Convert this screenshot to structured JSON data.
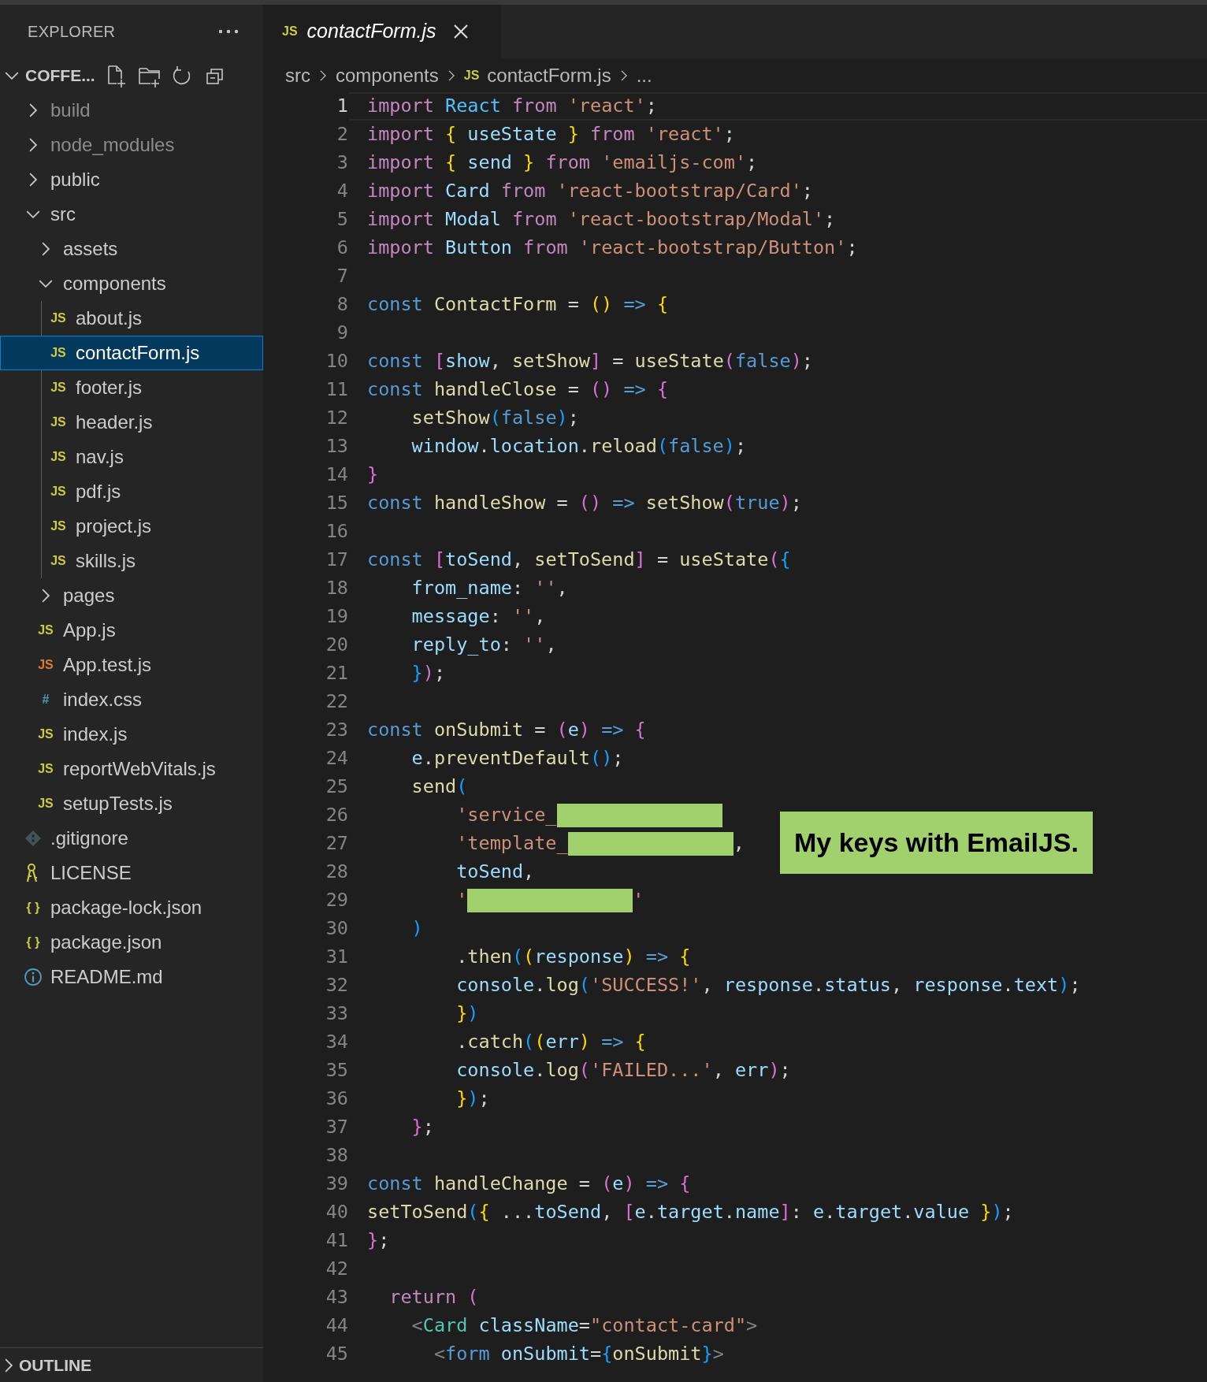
{
  "explorer": {
    "title": "EXPLORER"
  },
  "project": {
    "name": "COFFE...",
    "expanded": true
  },
  "tree": [
    {
      "label": "build",
      "kind": "folder",
      "expanded": false,
      "selected": false,
      "ignored": true
    },
    {
      "label": "node_modules",
      "kind": "folder",
      "expanded": false,
      "selected": false,
      "ignored": true
    },
    {
      "label": "public",
      "kind": "folder",
      "expanded": false,
      "selected": false
    },
    {
      "label": "src",
      "kind": "folder",
      "expanded": true,
      "selected": false,
      "children": [
        {
          "label": "assets",
          "kind": "folder",
          "expanded": false,
          "selected": false
        },
        {
          "label": "components",
          "kind": "folder",
          "expanded": true,
          "selected": false,
          "children": [
            {
              "label": "about.js",
              "kind": "js",
              "icon_text": "JS",
              "selected": false
            },
            {
              "label": "contactForm.js",
              "kind": "js",
              "icon_text": "JS",
              "selected": true
            },
            {
              "label": "footer.js",
              "kind": "js",
              "icon_text": "JS",
              "selected": false
            },
            {
              "label": "header.js",
              "kind": "js",
              "icon_text": "JS",
              "selected": false
            },
            {
              "label": "nav.js",
              "kind": "js",
              "icon_text": "JS",
              "selected": false
            },
            {
              "label": "pdf.js",
              "kind": "js",
              "icon_text": "JS",
              "selected": false
            },
            {
              "label": "project.js",
              "kind": "js",
              "icon_text": "JS",
              "selected": false
            },
            {
              "label": "skills.js",
              "kind": "js",
              "icon_text": "JS",
              "selected": false
            }
          ]
        },
        {
          "label": "pages",
          "kind": "folder",
          "expanded": false,
          "selected": false
        },
        {
          "label": "App.js",
          "kind": "js",
          "icon_text": "JS",
          "selected": false
        },
        {
          "label": "App.test.js",
          "kind": "js-test",
          "icon_text": "JS",
          "selected": false
        },
        {
          "label": "index.css",
          "kind": "css",
          "icon_text": "#",
          "selected": false
        },
        {
          "label": "index.js",
          "kind": "js",
          "icon_text": "JS",
          "selected": false
        },
        {
          "label": "reportWebVitals.js",
          "kind": "js",
          "icon_text": "JS",
          "selected": false
        },
        {
          "label": "setupTests.js",
          "kind": "js",
          "icon_text": "JS",
          "selected": false
        }
      ]
    },
    {
      "label": ".gitignore",
      "kind": "git",
      "selected": false
    },
    {
      "label": "LICENSE",
      "kind": "license",
      "selected": false
    },
    {
      "label": "package-lock.json",
      "kind": "json",
      "icon_text": "{ }",
      "selected": false
    },
    {
      "label": "package.json",
      "kind": "json",
      "icon_text": "{ }",
      "selected": false
    },
    {
      "label": "README.md",
      "kind": "info",
      "selected": false
    }
  ],
  "outline": {
    "title": "OUTLINE",
    "expanded": false
  },
  "tab": {
    "icon_text": "JS",
    "title": "contactForm.js"
  },
  "breadcrumbs": [
    {
      "label": "src"
    },
    {
      "label": "components"
    },
    {
      "label": "contactForm.js",
      "icon_text": "JS"
    },
    {
      "label": "..."
    }
  ],
  "lines": [
    {
      "number": "1",
      "current": true,
      "tokens": [
        {
          "text": "import ",
          "kind": "kw"
        },
        {
          "text": "React ",
          "kind": "cn"
        },
        {
          "text": "from ",
          "kind": "kw"
        },
        {
          "text": "'react'",
          "kind": "s"
        },
        {
          "text": ";",
          "kind": "p"
        }
      ]
    },
    {
      "number": "2",
      "current": false,
      "tokens": [
        {
          "text": "import ",
          "kind": "kw"
        },
        {
          "text": "{ ",
          "kind": "b1"
        },
        {
          "text": "useState ",
          "kind": "v"
        },
        {
          "text": "} ",
          "kind": "b1"
        },
        {
          "text": "from ",
          "kind": "kw"
        },
        {
          "text": "'react'",
          "kind": "s"
        },
        {
          "text": ";",
          "kind": "p"
        }
      ]
    },
    {
      "number": "3",
      "current": false,
      "tokens": [
        {
          "text": "import ",
          "kind": "kw"
        },
        {
          "text": "{ ",
          "kind": "b1"
        },
        {
          "text": "send ",
          "kind": "v"
        },
        {
          "text": "} ",
          "kind": "b1"
        },
        {
          "text": "from ",
          "kind": "kw"
        },
        {
          "text": "'emailjs-com'",
          "kind": "s"
        },
        {
          "text": ";",
          "kind": "p"
        }
      ]
    },
    {
      "number": "4",
      "current": false,
      "tokens": [
        {
          "text": "import ",
          "kind": "kw"
        },
        {
          "text": "Card ",
          "kind": "v"
        },
        {
          "text": "from ",
          "kind": "kw"
        },
        {
          "text": "'react-bootstrap/Card'",
          "kind": "s"
        },
        {
          "text": ";",
          "kind": "p"
        }
      ]
    },
    {
      "number": "5",
      "current": false,
      "tokens": [
        {
          "text": "import ",
          "kind": "kw"
        },
        {
          "text": "Modal ",
          "kind": "v"
        },
        {
          "text": "from ",
          "kind": "kw"
        },
        {
          "text": "'react-bootstrap/Modal'",
          "kind": "s"
        },
        {
          "text": ";",
          "kind": "p"
        }
      ]
    },
    {
      "number": "6",
      "current": false,
      "tokens": [
        {
          "text": "import ",
          "kind": "kw"
        },
        {
          "text": "Button ",
          "kind": "v"
        },
        {
          "text": "from ",
          "kind": "kw"
        },
        {
          "text": "'react-bootstrap/Button'",
          "kind": "s"
        },
        {
          "text": ";",
          "kind": "p"
        }
      ]
    },
    {
      "number": "7",
      "current": false
    },
    {
      "number": "8",
      "current": false,
      "tokens": [
        {
          "text": "const ",
          "kind": "st"
        },
        {
          "text": "ContactForm ",
          "kind": "fn"
        },
        {
          "text": "= ",
          "kind": "p"
        },
        {
          "text": "() ",
          "kind": "b1"
        },
        {
          "text": "=> ",
          "kind": "st"
        },
        {
          "text": "{",
          "kind": "b1"
        }
      ]
    },
    {
      "number": "9",
      "current": false
    },
    {
      "number": "10",
      "current": false,
      "tokens": [
        {
          "text": "const ",
          "kind": "st"
        },
        {
          "text": "[",
          "kind": "b2"
        },
        {
          "text": "show",
          "kind": "v"
        },
        {
          "text": ", ",
          "kind": "p"
        },
        {
          "text": "setShow",
          "kind": "fn"
        },
        {
          "text": "]",
          "kind": "b2"
        },
        {
          "text": " = ",
          "kind": "p"
        },
        {
          "text": "useState",
          "kind": "fn"
        },
        {
          "text": "(",
          "kind": "b2"
        },
        {
          "text": "false",
          "kind": "st"
        },
        {
          "text": ")",
          "kind": "b2"
        },
        {
          "text": ";",
          "kind": "p"
        }
      ]
    },
    {
      "number": "11",
      "current": false,
      "tokens": [
        {
          "text": "const ",
          "kind": "st"
        },
        {
          "text": "handleClose ",
          "kind": "fn"
        },
        {
          "text": "= ",
          "kind": "p"
        },
        {
          "text": "() ",
          "kind": "b2"
        },
        {
          "text": "=> ",
          "kind": "st"
        },
        {
          "text": "{",
          "kind": "b2"
        }
      ]
    },
    {
      "number": "12",
      "current": false,
      "tokens": [
        {
          "text": "    setShow",
          "kind": "fn"
        },
        {
          "text": "(",
          "kind": "b3"
        },
        {
          "text": "false",
          "kind": "st"
        },
        {
          "text": ")",
          "kind": "b3"
        },
        {
          "text": ";",
          "kind": "p"
        }
      ]
    },
    {
      "number": "13",
      "current": false,
      "tokens": [
        {
          "text": "    window",
          "kind": "v"
        },
        {
          "text": ".",
          "kind": "p"
        },
        {
          "text": "location",
          "kind": "v"
        },
        {
          "text": ".",
          "kind": "p"
        },
        {
          "text": "reload",
          "kind": "fn"
        },
        {
          "text": "(",
          "kind": "b3"
        },
        {
          "text": "false",
          "kind": "st"
        },
        {
          "text": ")",
          "kind": "b3"
        },
        {
          "text": ";",
          "kind": "p"
        }
      ]
    },
    {
      "number": "14",
      "current": false,
      "tokens": [
        {
          "text": "}",
          "kind": "b2"
        }
      ]
    },
    {
      "number": "15",
      "current": false,
      "tokens": [
        {
          "text": "const ",
          "kind": "st"
        },
        {
          "text": "handleShow ",
          "kind": "fn"
        },
        {
          "text": "= ",
          "kind": "p"
        },
        {
          "text": "() ",
          "kind": "b2"
        },
        {
          "text": "=> ",
          "kind": "st"
        },
        {
          "text": "setShow",
          "kind": "fn"
        },
        {
          "text": "(",
          "kind": "b2"
        },
        {
          "text": "true",
          "kind": "st"
        },
        {
          "text": ")",
          "kind": "b2"
        },
        {
          "text": ";",
          "kind": "p"
        }
      ]
    },
    {
      "number": "16",
      "current": false
    },
    {
      "number": "17",
      "current": false,
      "tokens": [
        {
          "text": "const ",
          "kind": "st"
        },
        {
          "text": "[",
          "kind": "b2"
        },
        {
          "text": "toSend",
          "kind": "v"
        },
        {
          "text": ", ",
          "kind": "p"
        },
        {
          "text": "setToSend",
          "kind": "fn"
        },
        {
          "text": "]",
          "kind": "b2"
        },
        {
          "text": " = ",
          "kind": "p"
        },
        {
          "text": "useState",
          "kind": "fn"
        },
        {
          "text": "(",
          "kind": "b2"
        },
        {
          "text": "{",
          "kind": "b3"
        }
      ]
    },
    {
      "number": "18",
      "current": false,
      "tokens": [
        {
          "text": "    from_name",
          "kind": "v"
        },
        {
          "text": ": ",
          "kind": "p"
        },
        {
          "text": "''",
          "kind": "s"
        },
        {
          "text": ",",
          "kind": "p"
        }
      ]
    },
    {
      "number": "19",
      "current": false,
      "tokens": [
        {
          "text": "    message",
          "kind": "v"
        },
        {
          "text": ": ",
          "kind": "p"
        },
        {
          "text": "''",
          "kind": "s"
        },
        {
          "text": ",",
          "kind": "p"
        }
      ]
    },
    {
      "number": "20",
      "current": false,
      "tokens": [
        {
          "text": "    reply_to",
          "kind": "v"
        },
        {
          "text": ": ",
          "kind": "p"
        },
        {
          "text": "''",
          "kind": "s"
        },
        {
          "text": ",",
          "kind": "p"
        }
      ]
    },
    {
      "number": "21",
      "current": false,
      "tokens": [
        {
          "text": "    }",
          "kind": "b3"
        },
        {
          "text": ")",
          "kind": "b2"
        },
        {
          "text": ";",
          "kind": "p"
        }
      ]
    },
    {
      "number": "22",
      "current": false
    },
    {
      "number": "23",
      "current": false,
      "tokens": [
        {
          "text": "const ",
          "kind": "st"
        },
        {
          "text": "onSubmit ",
          "kind": "fn"
        },
        {
          "text": "= ",
          "kind": "p"
        },
        {
          "text": "(",
          "kind": "b2"
        },
        {
          "text": "e",
          "kind": "v"
        },
        {
          "text": ") ",
          "kind": "b2"
        },
        {
          "text": "=> ",
          "kind": "st"
        },
        {
          "text": "{",
          "kind": "b2"
        }
      ]
    },
    {
      "number": "24",
      "current": false,
      "tokens": [
        {
          "text": "    e",
          "kind": "v"
        },
        {
          "text": ".",
          "kind": "p"
        },
        {
          "text": "preventDefault",
          "kind": "fn"
        },
        {
          "text": "()",
          "kind": "b3"
        },
        {
          "text": ";",
          "kind": "p"
        }
      ]
    },
    {
      "number": "25",
      "current": false,
      "tokens": [
        {
          "text": "    send",
          "kind": "fn"
        },
        {
          "text": "(",
          "kind": "b3"
        }
      ]
    },
    {
      "number": "26",
      "current": false,
      "tokens": [
        {
          "text": "        'service_",
          "kind": "s"
        },
        {
          "kind": "redacted"
        }
      ]
    },
    {
      "number": "27",
      "current": false,
      "tokens": [
        {
          "text": "        'template_",
          "kind": "s"
        },
        {
          "kind": "redacted"
        },
        {
          "text": ",",
          "kind": "p"
        }
      ]
    },
    {
      "number": "28",
      "current": false,
      "tokens": [
        {
          "text": "        toSend",
          "kind": "v"
        },
        {
          "text": ",",
          "kind": "p"
        }
      ]
    },
    {
      "number": "29",
      "current": false,
      "tokens": [
        {
          "text": "        '",
          "kind": "s"
        },
        {
          "kind": "redacted"
        },
        {
          "text": "'",
          "kind": "s"
        }
      ]
    },
    {
      "number": "30",
      "current": false,
      "tokens": [
        {
          "text": "    )",
          "kind": "b3"
        }
      ]
    },
    {
      "number": "31",
      "current": false,
      "tokens": [
        {
          "text": "        .",
          "kind": "p"
        },
        {
          "text": "then",
          "kind": "fn"
        },
        {
          "text": "(",
          "kind": "b3"
        },
        {
          "text": "(",
          "kind": "b1"
        },
        {
          "text": "response",
          "kind": "v"
        },
        {
          "text": ") ",
          "kind": "b1"
        },
        {
          "text": "=> ",
          "kind": "st"
        },
        {
          "text": "{",
          "kind": "b1"
        }
      ]
    },
    {
      "number": "32",
      "current": false,
      "tokens": [
        {
          "text": "        console",
          "kind": "v"
        },
        {
          "text": ".",
          "kind": "p"
        },
        {
          "text": "log",
          "kind": "fn"
        },
        {
          "text": "(",
          "kind": "b3"
        },
        {
          "text": "'SUCCESS!'",
          "kind": "s"
        },
        {
          "text": ", ",
          "kind": "p"
        },
        {
          "text": "response",
          "kind": "v"
        },
        {
          "text": ".",
          "kind": "p"
        },
        {
          "text": "status",
          "kind": "v"
        },
        {
          "text": ", ",
          "kind": "p"
        },
        {
          "text": "response",
          "kind": "v"
        },
        {
          "text": ".",
          "kind": "p"
        },
        {
          "text": "text",
          "kind": "v"
        },
        {
          "text": ")",
          "kind": "b3"
        },
        {
          "text": ";",
          "kind": "p"
        }
      ]
    },
    {
      "number": "33",
      "current": false,
      "tokens": [
        {
          "text": "        }",
          "kind": "b1"
        },
        {
          "text": ")",
          "kind": "b3"
        }
      ]
    },
    {
      "number": "34",
      "current": false,
      "tokens": [
        {
          "text": "        .",
          "kind": "p"
        },
        {
          "text": "catch",
          "kind": "fn"
        },
        {
          "text": "(",
          "kind": "b3"
        },
        {
          "text": "(",
          "kind": "b1"
        },
        {
          "text": "err",
          "kind": "v"
        },
        {
          "text": ") ",
          "kind": "b1"
        },
        {
          "text": "=> ",
          "kind": "st"
        },
        {
          "text": "{",
          "kind": "b1"
        }
      ]
    },
    {
      "number": "35",
      "current": false,
      "tokens": [
        {
          "text": "        console",
          "kind": "v"
        },
        {
          "text": ".",
          "kind": "p"
        },
        {
          "text": "log",
          "kind": "fn"
        },
        {
          "text": "(",
          "kind": "b2"
        },
        {
          "text": "'FAILED...'",
          "kind": "s"
        },
        {
          "text": ", ",
          "kind": "p"
        },
        {
          "text": "err",
          "kind": "v"
        },
        {
          "text": ")",
          "kind": "b2"
        },
        {
          "text": ";",
          "kind": "p"
        }
      ]
    },
    {
      "number": "36",
      "current": false,
      "tokens": [
        {
          "text": "        }",
          "kind": "b1"
        },
        {
          "text": ")",
          "kind": "b3"
        },
        {
          "text": ";",
          "kind": "p"
        }
      ]
    },
    {
      "number": "37",
      "current": false,
      "tokens": [
        {
          "text": "    }",
          "kind": "b2"
        },
        {
          "text": ";",
          "kind": "p"
        }
      ]
    },
    {
      "number": "38",
      "current": false
    },
    {
      "number": "39",
      "current": false,
      "tokens": [
        {
          "text": "const ",
          "kind": "st"
        },
        {
          "text": "handleChange ",
          "kind": "fn"
        },
        {
          "text": "= ",
          "kind": "p"
        },
        {
          "text": "(",
          "kind": "b2"
        },
        {
          "text": "e",
          "kind": "v"
        },
        {
          "text": ") ",
          "kind": "b2"
        },
        {
          "text": "=> ",
          "kind": "st"
        },
        {
          "text": "{",
          "kind": "b2"
        }
      ]
    },
    {
      "number": "40",
      "current": false,
      "tokens": [
        {
          "text": "setToSend",
          "kind": "fn"
        },
        {
          "text": "(",
          "kind": "b3"
        },
        {
          "text": "{ ",
          "kind": "b1"
        },
        {
          "text": "...",
          "kind": "p"
        },
        {
          "text": "toSend",
          "kind": "v"
        },
        {
          "text": ", ",
          "kind": "p"
        },
        {
          "text": "[",
          "kind": "b2"
        },
        {
          "text": "e",
          "kind": "v"
        },
        {
          "text": ".",
          "kind": "p"
        },
        {
          "text": "target",
          "kind": "v"
        },
        {
          "text": ".",
          "kind": "p"
        },
        {
          "text": "name",
          "kind": "v"
        },
        {
          "text": "]",
          "kind": "b2"
        },
        {
          "text": ": ",
          "kind": "p"
        },
        {
          "text": "e",
          "kind": "v"
        },
        {
          "text": ".",
          "kind": "p"
        },
        {
          "text": "target",
          "kind": "v"
        },
        {
          "text": ".",
          "kind": "p"
        },
        {
          "text": "value ",
          "kind": "v"
        },
        {
          "text": "}",
          "kind": "b1"
        },
        {
          "text": ")",
          "kind": "b3"
        },
        {
          "text": ";",
          "kind": "p"
        }
      ]
    },
    {
      "number": "41",
      "current": false,
      "tokens": [
        {
          "text": "}",
          "kind": "b2"
        },
        {
          "text": ";",
          "kind": "p"
        }
      ]
    },
    {
      "number": "42",
      "current": false
    },
    {
      "number": "43",
      "current": false,
      "tokens": [
        {
          "text": "  return ",
          "kind": "kw"
        },
        {
          "text": "(",
          "kind": "b2"
        }
      ]
    },
    {
      "number": "44",
      "current": false,
      "tokens": [
        {
          "text": "    <",
          "kind": "ang"
        },
        {
          "text": "Card ",
          "kind": "tg"
        },
        {
          "text": "className",
          "kind": "v"
        },
        {
          "text": "=",
          "kind": "p"
        },
        {
          "text": "\"contact-card\"",
          "kind": "s"
        },
        {
          "text": ">",
          "kind": "ang"
        }
      ]
    },
    {
      "number": "45",
      "current": false,
      "tokens": [
        {
          "text": "      <",
          "kind": "ang"
        },
        {
          "text": "form ",
          "kind": "st"
        },
        {
          "text": "onSubmit",
          "kind": "v"
        },
        {
          "text": "=",
          "kind": "p"
        },
        {
          "text": "{",
          "kind": "b3"
        },
        {
          "text": "onSubmit",
          "kind": "fn"
        },
        {
          "text": "}",
          "kind": "b3"
        },
        {
          "text": ">",
          "kind": "ang"
        }
      ]
    }
  ],
  "callout": {
    "text": "My keys with EmailJS."
  }
}
